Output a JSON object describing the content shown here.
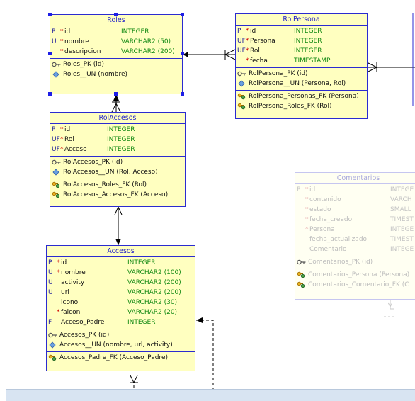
{
  "tables": {
    "roles": {
      "title": "Roles",
      "columns": [
        {
          "flag": "P",
          "req": "*",
          "name": "id",
          "type": "INTEGER"
        },
        {
          "flag": "U",
          "req": "*",
          "name": "nombre",
          "type": "VARCHAR2 (50)"
        },
        {
          "flag": "",
          "req": "*",
          "name": "descripcion",
          "type": "VARCHAR2 (200)"
        }
      ],
      "keys": [
        {
          "icon": "key-icon",
          "text": "Roles_PK (id)"
        },
        {
          "icon": "diamond-icon",
          "text": "Roles__UN (nombre)"
        }
      ],
      "fks": []
    },
    "rolpersona": {
      "title": "RolPersona",
      "columns": [
        {
          "flag": "P",
          "req": "*",
          "name": "id",
          "type": "INTEGER"
        },
        {
          "flag": "UF",
          "req": "*",
          "name": "Persona",
          "type": "INTEGER"
        },
        {
          "flag": "UF",
          "req": "*",
          "name": "Rol",
          "type": "INTEGER"
        },
        {
          "flag": "",
          "req": "*",
          "name": "fecha",
          "type": "TIMESTAMP"
        }
      ],
      "keys": [
        {
          "icon": "key-icon",
          "text": "RolPersona_PK (id)"
        },
        {
          "icon": "diamond-icon",
          "text": "RolPersona__UN (Persona, Rol)"
        }
      ],
      "fks": [
        {
          "icon": "fk-icon",
          "text": "RolPersona_Personas_FK (Persona)"
        },
        {
          "icon": "fk-icon",
          "text": "RolPersona_Roles_FK (Rol)"
        }
      ]
    },
    "rolaccesos": {
      "title": "RolAccesos",
      "columns": [
        {
          "flag": "P",
          "req": "*",
          "name": "id",
          "type": "INTEGER"
        },
        {
          "flag": "UF",
          "req": "*",
          "name": "Rol",
          "type": "INTEGER"
        },
        {
          "flag": "UF",
          "req": "*",
          "name": "Acceso",
          "type": "INTEGER"
        }
      ],
      "keys": [
        {
          "icon": "key-icon",
          "text": "RolAccesos_PK (id)"
        },
        {
          "icon": "diamond-icon",
          "text": "RolAccesos__UN (Rol, Acceso)"
        }
      ],
      "fks": [
        {
          "icon": "fk-icon",
          "text": "RolAccesos_Roles_FK (Rol)"
        },
        {
          "icon": "fk-icon",
          "text": "RolAccesos_Accesos_FK (Acceso)"
        }
      ]
    },
    "accesos": {
      "title": "Accesos",
      "columns": [
        {
          "flag": "P",
          "req": "*",
          "name": "id",
          "type": "INTEGER"
        },
        {
          "flag": "U",
          "req": "*",
          "name": "nombre",
          "type": "VARCHAR2 (100)"
        },
        {
          "flag": "U",
          "req": "",
          "name": "activity",
          "type": "VARCHAR2 (200)"
        },
        {
          "flag": "U",
          "req": "",
          "name": "url",
          "type": "VARCHAR2 (200)"
        },
        {
          "flag": "",
          "req": "",
          "name": "icono",
          "type": "VARCHAR2 (30)"
        },
        {
          "flag": "",
          "req": "*",
          "name": "faicon",
          "type": "VARCHAR2 (20)"
        },
        {
          "flag": "F",
          "req": "",
          "name": "Acceso_Padre",
          "type": "INTEGER"
        }
      ],
      "keys": [
        {
          "icon": "key-icon",
          "text": "Accesos_PK (id)"
        },
        {
          "icon": "diamond-icon",
          "text": "Accesos__UN (nombre, url, activity)"
        }
      ],
      "fks": [
        {
          "icon": "fk-icon",
          "text": "Accesos_Padre_FK (Acceso_Padre)"
        }
      ]
    },
    "comentarios": {
      "title": "Comentarios",
      "columns": [
        {
          "flag": "P",
          "req": "*",
          "name": "id",
          "type": "INTEGE"
        },
        {
          "flag": "",
          "req": "*",
          "name": "contenido",
          "type": "VARCH"
        },
        {
          "flag": "",
          "req": "*",
          "name": "estado",
          "type": "SMALL"
        },
        {
          "flag": "",
          "req": "*",
          "name": "fecha_creado",
          "type": "TIMEST"
        },
        {
          "flag": "",
          "req": "*",
          "name": "Persona",
          "type": "INTEGE"
        },
        {
          "flag": "",
          "req": "",
          "name": "fecha_actualizado",
          "type": "TIMEST"
        },
        {
          "flag": "",
          "req": "",
          "name": "Comentario",
          "type": "INTEGE"
        }
      ],
      "keys": [
        {
          "icon": "key-icon",
          "text": "Comentarios_PK (id)"
        }
      ],
      "fks": [
        {
          "icon": "fk-icon",
          "text": "Comentarios_Persona (Persona)"
        },
        {
          "icon": "fk-icon",
          "text": "Comentarios_Comentario_FK (C"
        }
      ]
    }
  }
}
